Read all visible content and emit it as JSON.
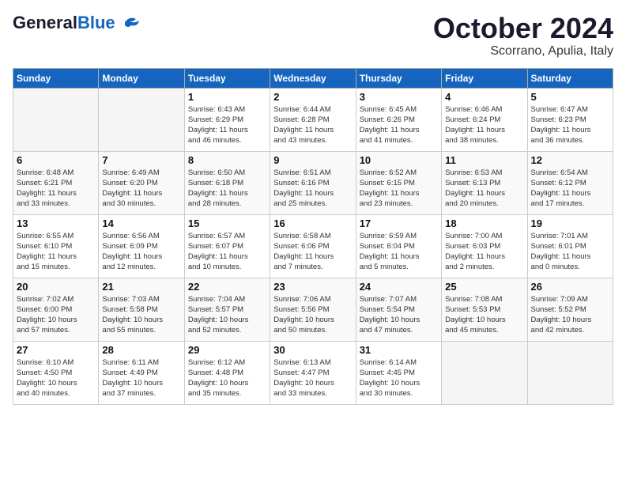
{
  "header": {
    "logo_general": "General",
    "logo_blue": "Blue",
    "month": "October 2024",
    "location": "Scorrano, Apulia, Italy"
  },
  "weekdays": [
    "Sunday",
    "Monday",
    "Tuesday",
    "Wednesday",
    "Thursday",
    "Friday",
    "Saturday"
  ],
  "weeks": [
    [
      {
        "day": "",
        "info": "",
        "empty": true
      },
      {
        "day": "",
        "info": "",
        "empty": true
      },
      {
        "day": "1",
        "info": "Sunrise: 6:43 AM\nSunset: 6:29 PM\nDaylight: 11 hours\nand 46 minutes.",
        "empty": false
      },
      {
        "day": "2",
        "info": "Sunrise: 6:44 AM\nSunset: 6:28 PM\nDaylight: 11 hours\nand 43 minutes.",
        "empty": false
      },
      {
        "day": "3",
        "info": "Sunrise: 6:45 AM\nSunset: 6:26 PM\nDaylight: 11 hours\nand 41 minutes.",
        "empty": false
      },
      {
        "day": "4",
        "info": "Sunrise: 6:46 AM\nSunset: 6:24 PM\nDaylight: 11 hours\nand 38 minutes.",
        "empty": false
      },
      {
        "day": "5",
        "info": "Sunrise: 6:47 AM\nSunset: 6:23 PM\nDaylight: 11 hours\nand 36 minutes.",
        "empty": false
      }
    ],
    [
      {
        "day": "6",
        "info": "Sunrise: 6:48 AM\nSunset: 6:21 PM\nDaylight: 11 hours\nand 33 minutes.",
        "empty": false
      },
      {
        "day": "7",
        "info": "Sunrise: 6:49 AM\nSunset: 6:20 PM\nDaylight: 11 hours\nand 30 minutes.",
        "empty": false
      },
      {
        "day": "8",
        "info": "Sunrise: 6:50 AM\nSunset: 6:18 PM\nDaylight: 11 hours\nand 28 minutes.",
        "empty": false
      },
      {
        "day": "9",
        "info": "Sunrise: 6:51 AM\nSunset: 6:16 PM\nDaylight: 11 hours\nand 25 minutes.",
        "empty": false
      },
      {
        "day": "10",
        "info": "Sunrise: 6:52 AM\nSunset: 6:15 PM\nDaylight: 11 hours\nand 23 minutes.",
        "empty": false
      },
      {
        "day": "11",
        "info": "Sunrise: 6:53 AM\nSunset: 6:13 PM\nDaylight: 11 hours\nand 20 minutes.",
        "empty": false
      },
      {
        "day": "12",
        "info": "Sunrise: 6:54 AM\nSunset: 6:12 PM\nDaylight: 11 hours\nand 17 minutes.",
        "empty": false
      }
    ],
    [
      {
        "day": "13",
        "info": "Sunrise: 6:55 AM\nSunset: 6:10 PM\nDaylight: 11 hours\nand 15 minutes.",
        "empty": false
      },
      {
        "day": "14",
        "info": "Sunrise: 6:56 AM\nSunset: 6:09 PM\nDaylight: 11 hours\nand 12 minutes.",
        "empty": false
      },
      {
        "day": "15",
        "info": "Sunrise: 6:57 AM\nSunset: 6:07 PM\nDaylight: 11 hours\nand 10 minutes.",
        "empty": false
      },
      {
        "day": "16",
        "info": "Sunrise: 6:58 AM\nSunset: 6:06 PM\nDaylight: 11 hours\nand 7 minutes.",
        "empty": false
      },
      {
        "day": "17",
        "info": "Sunrise: 6:59 AM\nSunset: 6:04 PM\nDaylight: 11 hours\nand 5 minutes.",
        "empty": false
      },
      {
        "day": "18",
        "info": "Sunrise: 7:00 AM\nSunset: 6:03 PM\nDaylight: 11 hours\nand 2 minutes.",
        "empty": false
      },
      {
        "day": "19",
        "info": "Sunrise: 7:01 AM\nSunset: 6:01 PM\nDaylight: 11 hours\nand 0 minutes.",
        "empty": false
      }
    ],
    [
      {
        "day": "20",
        "info": "Sunrise: 7:02 AM\nSunset: 6:00 PM\nDaylight: 10 hours\nand 57 minutes.",
        "empty": false
      },
      {
        "day": "21",
        "info": "Sunrise: 7:03 AM\nSunset: 5:58 PM\nDaylight: 10 hours\nand 55 minutes.",
        "empty": false
      },
      {
        "day": "22",
        "info": "Sunrise: 7:04 AM\nSunset: 5:57 PM\nDaylight: 10 hours\nand 52 minutes.",
        "empty": false
      },
      {
        "day": "23",
        "info": "Sunrise: 7:06 AM\nSunset: 5:56 PM\nDaylight: 10 hours\nand 50 minutes.",
        "empty": false
      },
      {
        "day": "24",
        "info": "Sunrise: 7:07 AM\nSunset: 5:54 PM\nDaylight: 10 hours\nand 47 minutes.",
        "empty": false
      },
      {
        "day": "25",
        "info": "Sunrise: 7:08 AM\nSunset: 5:53 PM\nDaylight: 10 hours\nand 45 minutes.",
        "empty": false
      },
      {
        "day": "26",
        "info": "Sunrise: 7:09 AM\nSunset: 5:52 PM\nDaylight: 10 hours\nand 42 minutes.",
        "empty": false
      }
    ],
    [
      {
        "day": "27",
        "info": "Sunrise: 6:10 AM\nSunset: 4:50 PM\nDaylight: 10 hours\nand 40 minutes.",
        "empty": false
      },
      {
        "day": "28",
        "info": "Sunrise: 6:11 AM\nSunset: 4:49 PM\nDaylight: 10 hours\nand 37 minutes.",
        "empty": false
      },
      {
        "day": "29",
        "info": "Sunrise: 6:12 AM\nSunset: 4:48 PM\nDaylight: 10 hours\nand 35 minutes.",
        "empty": false
      },
      {
        "day": "30",
        "info": "Sunrise: 6:13 AM\nSunset: 4:47 PM\nDaylight: 10 hours\nand 33 minutes.",
        "empty": false
      },
      {
        "day": "31",
        "info": "Sunrise: 6:14 AM\nSunset: 4:45 PM\nDaylight: 10 hours\nand 30 minutes.",
        "empty": false
      },
      {
        "day": "",
        "info": "",
        "empty": true
      },
      {
        "day": "",
        "info": "",
        "empty": true
      }
    ]
  ]
}
